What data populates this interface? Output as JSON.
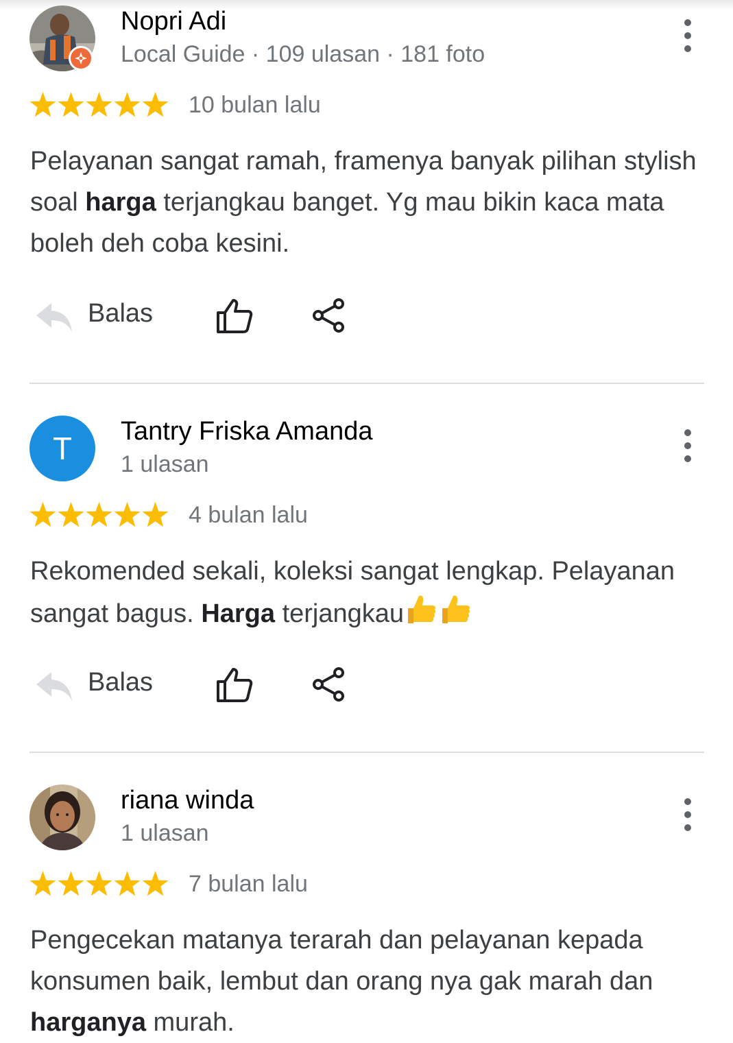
{
  "reviews": [
    {
      "name": "Nopri Adi",
      "meta": "Local Guide · 109 ulasan · 181 foto",
      "rating": 5,
      "time": "10 bulan lalu",
      "text_parts": [
        "Pelayanan sangat ramah, framenya banyak pilihan stylish soal ",
        "harga",
        " terjangkau banget. Yg mau bikin kaca mata boleh deh coba kesini."
      ],
      "avatar": "photo"
    },
    {
      "name": "Tantry Friska Amanda",
      "meta": "1 ulasan",
      "rating": 5,
      "time": "4 bulan lalu",
      "initial": "T",
      "avatar_color": "#1a8fe0",
      "text_parts": [
        "Rekomended sekali, koleksi sangat lengkap. Pelayanan sangat bagus. ",
        "Harga",
        " terjangkau"
      ],
      "emoji": "thumbs-up-emoji x2"
    },
    {
      "name": "riana winda",
      "meta": "1 ulasan",
      "rating": 5,
      "time": "7 bulan lalu",
      "text_parts": [
        "Pengecekan matanya terarah dan pelayanan kepada konsumen baik, lembut dan orang nya gak marah dan ",
        "harganya",
        " murah."
      ],
      "avatar": "photo"
    }
  ],
  "actions": {
    "reply_label": "Balas",
    "like_icon": "thumb-up-icon",
    "share_icon": "share-icon",
    "reply_icon": "reply-icon"
  },
  "colors": {
    "star": "#fbbc04",
    "secondary_text": "#70757a",
    "local_guide_badge": "#ee6a3a"
  }
}
